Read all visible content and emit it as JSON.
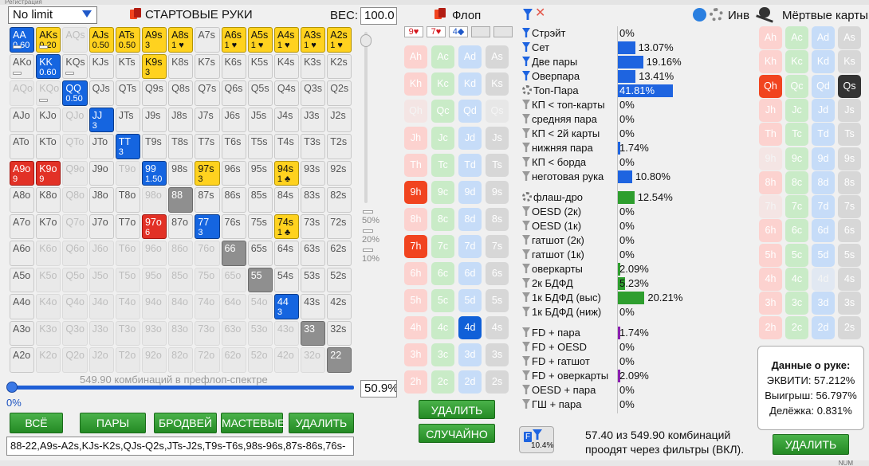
{
  "window": {
    "caption": "Регистрация"
  },
  "limit_select": {
    "value": "No limit"
  },
  "starting_hands": {
    "title": "СТАРТОВЫЕ РУКИ",
    "weight_label": "ВЕС:",
    "weight_value": "100.0"
  },
  "grid_rows": [
    [
      [
        "AA",
        "blue",
        "0.60",
        true
      ],
      [
        "AKs",
        "yellow",
        "0.20",
        true
      ],
      [
        "AQs",
        "dim",
        "",
        false
      ],
      [
        "AJs",
        "yellow",
        "0.50",
        false
      ],
      [
        "ATs",
        "yellow",
        "0.50",
        false
      ],
      [
        "A9s",
        "yellow",
        "3",
        false
      ],
      [
        "A8s",
        "yellow",
        "1 ♥",
        false
      ],
      [
        "A7s",
        "",
        "",
        false
      ],
      [
        "A6s",
        "yellow",
        "1 ♥",
        false
      ],
      [
        "A5s",
        "yellow",
        "1 ♥",
        false
      ],
      [
        "A4s",
        "yellow",
        "1 ♥",
        false
      ],
      [
        "A3s",
        "yellow",
        "1 ♥",
        false
      ],
      [
        "A2s",
        "yellow",
        "1 ♥",
        false
      ]
    ],
    [
      [
        "AKo",
        "",
        "",
        true
      ],
      [
        "KK",
        "blue",
        "0.60",
        false
      ],
      [
        "KQs",
        "",
        "",
        true
      ],
      [
        "KJs",
        "",
        "",
        false
      ],
      [
        "KTs",
        "",
        "",
        false
      ],
      [
        "K9s",
        "yellow",
        "3",
        false
      ],
      [
        "K8s",
        "",
        "",
        false
      ],
      [
        "K7s",
        "",
        "",
        false
      ],
      [
        "K6s",
        "",
        "",
        false
      ],
      [
        "K5s",
        "",
        "",
        false
      ],
      [
        "K4s",
        "",
        "",
        false
      ],
      [
        "K3s",
        "",
        "",
        false
      ],
      [
        "K2s",
        "",
        "",
        false
      ]
    ],
    [
      [
        "AQo",
        "dim",
        "",
        false
      ],
      [
        "KQo",
        "dim",
        "",
        true
      ],
      [
        "QQ",
        "blue",
        "0.50",
        false
      ],
      [
        "QJs",
        "",
        "",
        false
      ],
      [
        "QTs",
        "",
        "",
        false
      ],
      [
        "Q9s",
        "",
        "",
        false
      ],
      [
        "Q8s",
        "",
        "",
        false
      ],
      [
        "Q7s",
        "",
        "",
        false
      ],
      [
        "Q6s",
        "",
        "",
        false
      ],
      [
        "Q5s",
        "",
        "",
        false
      ],
      [
        "Q4s",
        "",
        "",
        false
      ],
      [
        "Q3s",
        "",
        "",
        false
      ],
      [
        "Q2s",
        "",
        "",
        false
      ]
    ],
    [
      [
        "AJo",
        "",
        "",
        false
      ],
      [
        "KJo",
        "",
        "",
        false
      ],
      [
        "QJo",
        "dim",
        "",
        false
      ],
      [
        "JJ",
        "blue",
        "3",
        false
      ],
      [
        "JTs",
        "",
        "",
        false
      ],
      [
        "J9s",
        "",
        "",
        false
      ],
      [
        "J8s",
        "",
        "",
        false
      ],
      [
        "J7s",
        "",
        "",
        false
      ],
      [
        "J6s",
        "",
        "",
        false
      ],
      [
        "J5s",
        "",
        "",
        false
      ],
      [
        "J4s",
        "",
        "",
        false
      ],
      [
        "J3s",
        "",
        "",
        false
      ],
      [
        "J2s",
        "",
        "",
        false
      ]
    ],
    [
      [
        "ATo",
        "",
        "",
        false
      ],
      [
        "KTo",
        "",
        "",
        false
      ],
      [
        "QTo",
        "dim",
        "",
        false
      ],
      [
        "JTo",
        "",
        "",
        false
      ],
      [
        "TT",
        "blue",
        "3",
        false
      ],
      [
        "T9s",
        "",
        "",
        false
      ],
      [
        "T8s",
        "",
        "",
        false
      ],
      [
        "T7s",
        "",
        "",
        false
      ],
      [
        "T6s",
        "",
        "",
        false
      ],
      [
        "T5s",
        "",
        "",
        false
      ],
      [
        "T4s",
        "",
        "",
        false
      ],
      [
        "T3s",
        "",
        "",
        false
      ],
      [
        "T2s",
        "",
        "",
        false
      ]
    ],
    [
      [
        "A9o",
        "red",
        "9",
        false
      ],
      [
        "K9o",
        "red",
        "9",
        false
      ],
      [
        "Q9o",
        "dim",
        "",
        false
      ],
      [
        "J9o",
        "",
        "",
        false
      ],
      [
        "T9o",
        "dim",
        "",
        false
      ],
      [
        "99",
        "blue",
        "1.50",
        false
      ],
      [
        "98s",
        "",
        "",
        false
      ],
      [
        "97s",
        "yellow",
        "3",
        false
      ],
      [
        "96s",
        "",
        "",
        false
      ],
      [
        "95s",
        "",
        "",
        false
      ],
      [
        "94s",
        "yellow",
        "1 ♣",
        false
      ],
      [
        "93s",
        "",
        "",
        false
      ],
      [
        "92s",
        "",
        "",
        false
      ]
    ],
    [
      [
        "A8o",
        "",
        "",
        false
      ],
      [
        "K8o",
        "",
        "",
        false
      ],
      [
        "Q8o",
        "dim",
        "",
        false
      ],
      [
        "J8o",
        "",
        "",
        false
      ],
      [
        "T8o",
        "",
        "",
        false
      ],
      [
        "98o",
        "dim",
        "",
        false
      ],
      [
        "88",
        "gray",
        "",
        false
      ],
      [
        "87s",
        "",
        "",
        false
      ],
      [
        "86s",
        "",
        "",
        false
      ],
      [
        "85s",
        "",
        "",
        false
      ],
      [
        "84s",
        "",
        "",
        false
      ],
      [
        "83s",
        "",
        "",
        false
      ],
      [
        "82s",
        "",
        "",
        false
      ]
    ],
    [
      [
        "A7o",
        "",
        "",
        false
      ],
      [
        "K7o",
        "",
        "",
        false
      ],
      [
        "Q7o",
        "dim",
        "",
        false
      ],
      [
        "J7o",
        "",
        "",
        false
      ],
      [
        "T7o",
        "",
        "",
        false
      ],
      [
        "97o",
        "red",
        "6",
        false
      ],
      [
        "87o",
        "",
        "",
        false
      ],
      [
        "77",
        "blue",
        "3",
        false
      ],
      [
        "76s",
        "",
        "",
        false
      ],
      [
        "75s",
        "",
        "",
        false
      ],
      [
        "74s",
        "yellow",
        "1 ♣",
        false
      ],
      [
        "73s",
        "",
        "",
        false
      ],
      [
        "72s",
        "",
        "",
        false
      ]
    ],
    [
      [
        "A6o",
        "",
        "",
        false
      ],
      [
        "K6o",
        "dim",
        "",
        false
      ],
      [
        "Q6o",
        "dim",
        "",
        false
      ],
      [
        "J6o",
        "dim",
        "",
        false
      ],
      [
        "T6o",
        "dim",
        "",
        false
      ],
      [
        "96o",
        "dim",
        "",
        false
      ],
      [
        "86o",
        "dim",
        "",
        false
      ],
      [
        "76o",
        "dim",
        "",
        false
      ],
      [
        "66",
        "gray",
        "",
        false
      ],
      [
        "65s",
        "",
        "",
        false
      ],
      [
        "64s",
        "",
        "",
        false
      ],
      [
        "63s",
        "",
        "",
        false
      ],
      [
        "62s",
        "",
        "",
        false
      ]
    ],
    [
      [
        "A5o",
        "",
        "",
        false
      ],
      [
        "K5o",
        "dim",
        "",
        false
      ],
      [
        "Q5o",
        "dim",
        "",
        false
      ],
      [
        "J5o",
        "dim",
        "",
        false
      ],
      [
        "T5o",
        "dim",
        "",
        false
      ],
      [
        "95o",
        "dim",
        "",
        false
      ],
      [
        "85o",
        "dim",
        "",
        false
      ],
      [
        "75o",
        "dim",
        "",
        false
      ],
      [
        "65o",
        "dim",
        "",
        false
      ],
      [
        "55",
        "gray",
        "",
        false
      ],
      [
        "54s",
        "",
        "",
        false
      ],
      [
        "53s",
        "",
        "",
        false
      ],
      [
        "52s",
        "",
        "",
        false
      ]
    ],
    [
      [
        "A4o",
        "",
        "",
        false
      ],
      [
        "K4o",
        "dim",
        "",
        false
      ],
      [
        "Q4o",
        "dim",
        "",
        false
      ],
      [
        "J4o",
        "dim",
        "",
        false
      ],
      [
        "T4o",
        "dim",
        "",
        false
      ],
      [
        "94o",
        "dim",
        "",
        false
      ],
      [
        "84o",
        "dim",
        "",
        false
      ],
      [
        "74o",
        "dim",
        "",
        false
      ],
      [
        "64o",
        "dim",
        "",
        false
      ],
      [
        "54o",
        "dim",
        "",
        false
      ],
      [
        "44",
        "blue",
        "3",
        false
      ],
      [
        "43s",
        "",
        "",
        false
      ],
      [
        "42s",
        "",
        "",
        false
      ]
    ],
    [
      [
        "A3o",
        "",
        "",
        false
      ],
      [
        "K3o",
        "dim",
        "",
        false
      ],
      [
        "Q3o",
        "dim",
        "",
        false
      ],
      [
        "J3o",
        "dim",
        "",
        false
      ],
      [
        "T3o",
        "dim",
        "",
        false
      ],
      [
        "93o",
        "dim",
        "",
        false
      ],
      [
        "83o",
        "dim",
        "",
        false
      ],
      [
        "73o",
        "dim",
        "",
        false
      ],
      [
        "63o",
        "dim",
        "",
        false
      ],
      [
        "53o",
        "dim",
        "",
        false
      ],
      [
        "43o",
        "dim",
        "",
        false
      ],
      [
        "33",
        "gray",
        "",
        false
      ],
      [
        "32s",
        "",
        "",
        false
      ]
    ],
    [
      [
        "A2o",
        "",
        "",
        false
      ],
      [
        "K2o",
        "dim",
        "",
        false
      ],
      [
        "Q2o",
        "dim",
        "",
        false
      ],
      [
        "J2o",
        "dim",
        "",
        false
      ],
      [
        "T2o",
        "dim",
        "",
        false
      ],
      [
        "92o",
        "dim",
        "",
        false
      ],
      [
        "82o",
        "dim",
        "",
        false
      ],
      [
        "72o",
        "dim",
        "",
        false
      ],
      [
        "62o",
        "dim",
        "",
        false
      ],
      [
        "52o",
        "dim",
        "",
        false
      ],
      [
        "42o",
        "dim",
        "",
        false
      ],
      [
        "32o",
        "dim",
        "",
        false
      ],
      [
        "22",
        "gray",
        "",
        false
      ]
    ]
  ],
  "weight_slider": {
    "levels": [
      "50%",
      "20%",
      "10%"
    ]
  },
  "range": {
    "combos_text": "549.90 комбинаций в префлоп-спектре",
    "slider_min": "0%",
    "slider_percent": "50.9%",
    "text": "88-22,A9s-A2s,KJs-K2s,QJs-Q2s,JTs-J2s,T9s-T6s,98s-96s,87s-86s,76s-"
  },
  "range_buttons": [
    "ВСЁ",
    "ПАРЫ",
    "БРОДВЕЙ",
    "МАСТЕВЫЕ",
    "УДАЛИТЬ"
  ],
  "flop": {
    "title": "Флоп",
    "boxes": [
      "9♥",
      "7♥",
      "4◆",
      "",
      ""
    ],
    "delete_label": "УДАЛИТЬ",
    "random_label": "СЛУЧАЙНО"
  },
  "flop_cards": [
    [
      "Ah",
      "Ac",
      "Ad",
      "As"
    ],
    [
      "Kh",
      "Kc",
      "Kd",
      "Ks"
    ],
    [
      "Qh",
      "Qc",
      "Qd",
      "Qs"
    ],
    [
      "Jh",
      "Jc",
      "Jd",
      "Js"
    ],
    [
      "Th",
      "Tc",
      "Td",
      "Ts"
    ],
    [
      "9h",
      "9c",
      "9d",
      "9s"
    ],
    [
      "8h",
      "8c",
      "8d",
      "8s"
    ],
    [
      "7h",
      "7c",
      "7d",
      "7s"
    ],
    [
      "6h",
      "6c",
      "6d",
      "6s"
    ],
    [
      "5h",
      "5c",
      "5d",
      "5s"
    ],
    [
      "4h",
      "4c",
      "4d",
      "4s"
    ],
    [
      "3h",
      "3c",
      "3d",
      "3s"
    ],
    [
      "2h",
      "2c",
      "2d",
      "2s"
    ]
  ],
  "flop_selected": [
    "9h",
    "7h",
    "4d"
  ],
  "flop_faded": [
    "Qh",
    "Qs"
  ],
  "stats": {
    "inv_label": "Инв",
    "rows": [
      [
        "Стрэйт",
        "0%",
        "blue",
        0
      ],
      [
        "Сет",
        "13.07%",
        "blue",
        13.07
      ],
      [
        "Две пары",
        "19.16%",
        "blue",
        19.16
      ],
      [
        "Оверпара",
        "13.41%",
        "blue",
        13.41
      ],
      [
        "Топ-Пара",
        "41.81%",
        "gear",
        41.81
      ],
      [
        "КП < топ-карты",
        "0%",
        "grey",
        0
      ],
      [
        "средняя пара",
        "0%",
        "grey",
        0
      ],
      [
        "КП < 2й карты",
        "0%",
        "grey",
        0
      ],
      [
        "нижняя пара",
        "1.74%",
        "grey",
        1.74
      ],
      [
        "КП < борда",
        "0%",
        "grey",
        0
      ],
      [
        "неготовая рука",
        "10.80%",
        "grey",
        10.8
      ]
    ],
    "draw_rows": [
      [
        "флаш-дро",
        "12.54%",
        "gear",
        12.54
      ],
      [
        "OESD (2к)",
        "0%",
        "grey",
        0
      ],
      [
        "OESD (1к)",
        "0%",
        "grey",
        0
      ],
      [
        "гатшот (2к)",
        "0%",
        "grey",
        0
      ],
      [
        "гатшот (1к)",
        "0%",
        "grey",
        0
      ],
      [
        "оверкарты",
        "2.09%",
        "grey",
        2.09
      ],
      [
        "2к БДФД",
        "5.23%",
        "grey",
        5.23
      ],
      [
        "1к БДФД (выс)",
        "20.21%",
        "grey",
        20.21
      ],
      [
        "1к БДФД (ниж)",
        "0%",
        "grey",
        0
      ]
    ],
    "combo_rows": [
      [
        "FD + пара",
        "1.74%",
        "grey",
        1.74
      ],
      [
        "FD + OESD",
        "0%",
        "grey",
        0
      ],
      [
        "FD + гатшот",
        "0%",
        "grey",
        0
      ],
      [
        "FD + оверкарты",
        "2.09%",
        "grey",
        2.09
      ],
      [
        "OESD + пара",
        "0%",
        "grey",
        0
      ],
      [
        "ГШ + пара",
        "0%",
        "grey",
        0
      ]
    ],
    "filter_badge": "10.4%",
    "filter_text": "57.40 из 549.90 комбинаций проодят через фильтры (ВКЛ)."
  },
  "dead": {
    "title": "Мёртвые карты",
    "selected": [
      "Qh",
      "Qs"
    ],
    "faded": [
      "9h",
      "7h",
      "4d"
    ],
    "delete_label": "УДАЛИТЬ"
  },
  "hand_data": {
    "title": "Данные о руке:",
    "equity": "ЭКВИТИ: 57.212%",
    "win": "Выигрыш: 56.797%",
    "tie": "Делёжка: 0.831%"
  },
  "status": {
    "num": "NUM"
  },
  "colors": {
    "blue": "#1565e0",
    "yellow": "#ffd21f",
    "red": "#e23126",
    "green": "#2e9e2e"
  }
}
